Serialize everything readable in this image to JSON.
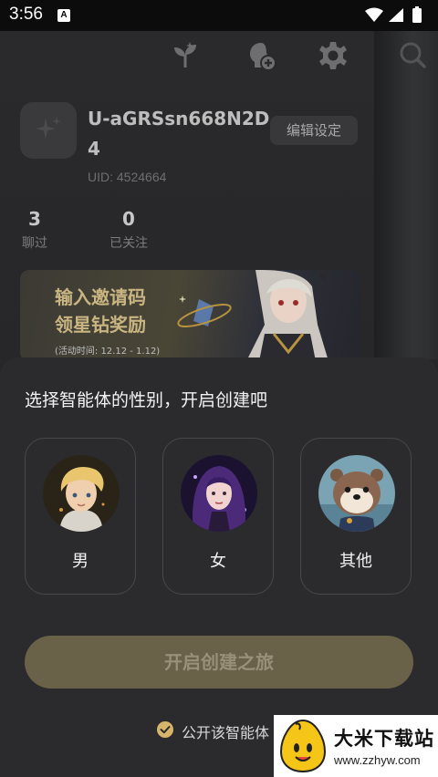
{
  "status_bar": {
    "time": "3:56",
    "notification_badge": "A"
  },
  "profile": {
    "username": "U-aGRSsn668N2D4",
    "uid": "UID: 4524664",
    "edit_label": "编辑设定",
    "stats": [
      {
        "value": "3",
        "label": "聊过"
      },
      {
        "value": "0",
        "label": "已关注"
      }
    ]
  },
  "banner": {
    "line1": "输入邀请码",
    "line2": "领星钻奖励",
    "period": "(活动时间: 12.12 - 1.12)"
  },
  "sheet": {
    "title": "选择智能体的性别，开启创建吧",
    "options": [
      {
        "label": "男"
      },
      {
        "label": "女"
      },
      {
        "label": "其他"
      }
    ],
    "start_button": "开启创建之旅",
    "public_label": "公开该智能体"
  },
  "watermark": {
    "title": "大米下载站",
    "url": "www.zzhyw.com"
  }
}
